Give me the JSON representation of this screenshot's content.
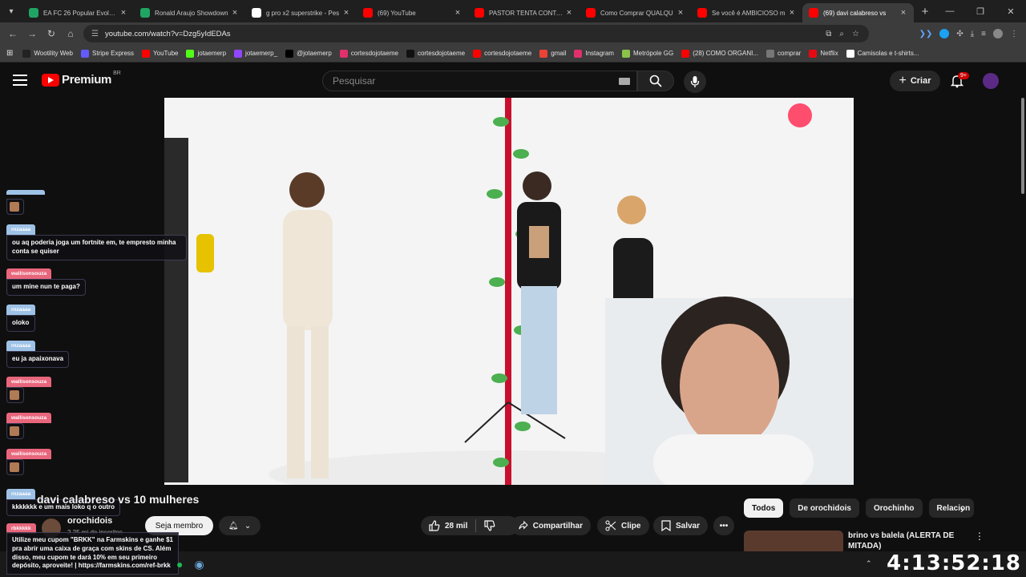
{
  "browser": {
    "tabs": [
      {
        "title": "EA FC 26 Popular Evolutio",
        "favicon_color": "#1fa463",
        "favicon_glyph": "sheets-icon"
      },
      {
        "title": "Ronald Araujo Showdown",
        "favicon_color": "#1fa463",
        "favicon_glyph": "sheets-icon"
      },
      {
        "title": "g pro x2 superstrike - Pes",
        "favicon_color": "#ffffff",
        "favicon_glyph": "google-icon"
      },
      {
        "title": "(69) YouTube",
        "favicon_color": "#ff0000",
        "favicon_glyph": "youtube-icon"
      },
      {
        "title": "PASTOR TENTA CONTAR",
        "favicon_color": "#ff0000",
        "favicon_glyph": "youtube-icon"
      },
      {
        "title": "Como Comprar QUALQU",
        "favicon_color": "#ff0000",
        "favicon_glyph": "youtube-icon"
      },
      {
        "title": "Se você é AMBICIOSO m",
        "favicon_color": "#ff0000",
        "favicon_glyph": "youtube-icon"
      },
      {
        "title": "(69) davi calabreso vs",
        "favicon_color": "#ff0000",
        "favicon_glyph": "youtube-icon",
        "active": true
      }
    ],
    "url": "youtube.com/watch?v=Dzg5yIdEDAs",
    "bookmarks": [
      {
        "label": "Wootility Web",
        "color": "#222"
      },
      {
        "label": "Stripe Express",
        "color": "#635bff"
      },
      {
        "label": "YouTube",
        "color": "#ff0000"
      },
      {
        "label": "jotaemerp",
        "color": "#53fc18"
      },
      {
        "label": "jotaemerp_",
        "color": "#9146ff"
      },
      {
        "label": "@jotaemerp",
        "color": "#000000"
      },
      {
        "label": "cortesdojotaeme",
        "color": "#e1306c"
      },
      {
        "label": "cortesdojotaeme",
        "color": "#111111"
      },
      {
        "label": "cortesdojotaeme",
        "color": "#ff0000"
      },
      {
        "label": "gmail",
        "color": "#ea4335"
      },
      {
        "label": "Instagram",
        "color": "#e1306c"
      },
      {
        "label": "Metrópole GG",
        "color": "#8bc34a"
      },
      {
        "label": "(28) COMO ORGANI...",
        "color": "#ff0000"
      },
      {
        "label": "comprar",
        "color": "#777"
      },
      {
        "label": "Netflix",
        "color": "#e50914"
      },
      {
        "label": "Camisolas e t-shirts...",
        "color": "#ffffff"
      }
    ]
  },
  "youtube": {
    "logo_text": "Premium",
    "country_code": "BR",
    "search_placeholder": "Pesquisar",
    "create_label": "Criar",
    "notification_count": "9+"
  },
  "overlay": {
    "chat": [
      {
        "user": "",
        "text": "",
        "user_color": "#9ec2e6",
        "emote": true
      },
      {
        "user": "rnzaaaa",
        "text": "ou aq poderia joga um fortnite em, te empresto minha conta se quiser",
        "user_color": "#9ec2e6"
      },
      {
        "user": "wallisonsouza",
        "text": "um mine nun te paga?",
        "user_color": "#e8667c"
      },
      {
        "user": "rnzaaaa",
        "text": "oloko",
        "user_color": "#9ec2e6"
      },
      {
        "user": "rnzaaaa",
        "text": "eu ja apaixonava",
        "user_color": "#9ec2e6"
      },
      {
        "user": "wallisonsouza",
        "text": "",
        "user_color": "#e8667c",
        "emote": true
      },
      {
        "user": "wallisonsouza",
        "text": "",
        "user_color": "#e8667c",
        "emote": true
      },
      {
        "user": "wallisonsouza",
        "text": "",
        "user_color": "#e8667c",
        "emote": true
      },
      {
        "user": "rnzaaaa",
        "text": "kkkkkkk e um mais loko q o outro",
        "user_color": "#9ec2e6"
      },
      {
        "user": "rbkkkkk",
        "text": "",
        "user_color": "#e8667c"
      }
    ],
    "promo_text": "Utilize meu cupom \"BRKK\" na Farmskins e ganhe $1 pra abrir uma caixa de graça com skins de CS. Além disso, meu cupom te dará 10% em seu primeiro depósito, aproveite! | https://farmskins.com/ref-brkk",
    "clock": "4:13:52:18"
  },
  "video": {
    "title": "davi calabreso vs 10 mulheres",
    "channel_name": "orochidois",
    "subscribers": "2,25 mi de inscritos",
    "join_label": "Seja membro",
    "likes": "28 mil",
    "share_label": "Compartilhar",
    "clip_label": "Clipe",
    "save_label": "Salvar"
  },
  "sidebar": {
    "chips": [
      {
        "label": "Todos",
        "active": true
      },
      {
        "label": "De orochidois",
        "active": false
      },
      {
        "label": "Orochinho",
        "active": false
      },
      {
        "label": "Relacion",
        "active": false
      }
    ],
    "recommendation": {
      "title": "brino vs balela (ALERTA DE MITADA)"
    }
  },
  "colors": {
    "brand": "#ff0000",
    "background": "#0f0f0f",
    "chip_active": "#f1f1f1"
  }
}
